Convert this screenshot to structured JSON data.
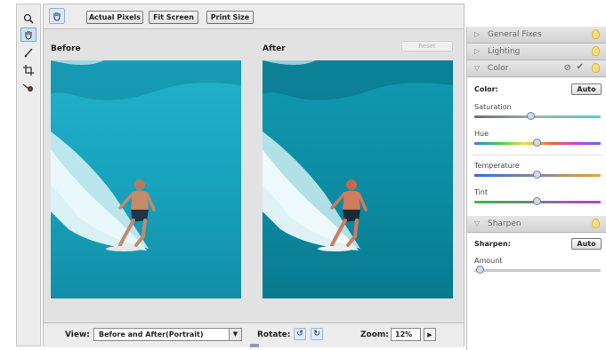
{
  "tools": [
    {
      "name": "zoom-tool",
      "glyph": "🔍"
    },
    {
      "name": "hand-tool",
      "glyph": "✋"
    },
    {
      "name": "quick-selection-tool",
      "glyph": "⁄"
    },
    {
      "name": "crop-tool",
      "glyph": "⌗"
    },
    {
      "name": "red-eye-tool",
      "glyph": "◉"
    }
  ],
  "toolbar": {
    "actual_pixels": "Actual Pixels",
    "fit_screen": "Fit Screen",
    "print_size": "Print Size"
  },
  "preview": {
    "before_label": "Before",
    "after_label": "After",
    "reset_label": "Reset"
  },
  "bottom": {
    "view_label": "View:",
    "view_value": "Before and After(Portrait)",
    "rotate_label": "Rotate:",
    "zoom_label": "Zoom:",
    "zoom_value": "12%"
  },
  "panel": {
    "general_fixes": "General Fixes",
    "lighting": "Lighting",
    "color": "Color",
    "color_title": "Color:",
    "auto": "Auto",
    "saturation": "Saturation",
    "hue": "Hue",
    "temperature": "Temperature",
    "tint": "Tint",
    "sharpen": "Sharpen",
    "sharpen_title": "Sharpen:",
    "amount": "Amount",
    "sliders": {
      "saturation": 0.45,
      "hue": 0.5,
      "temperature": 0.5,
      "tint": 0.5,
      "amount": 0.05
    }
  },
  "colors": {
    "before_water": "#1aa6bf",
    "after_water": "#0c8fa1",
    "accent": "#7ea4d6"
  }
}
